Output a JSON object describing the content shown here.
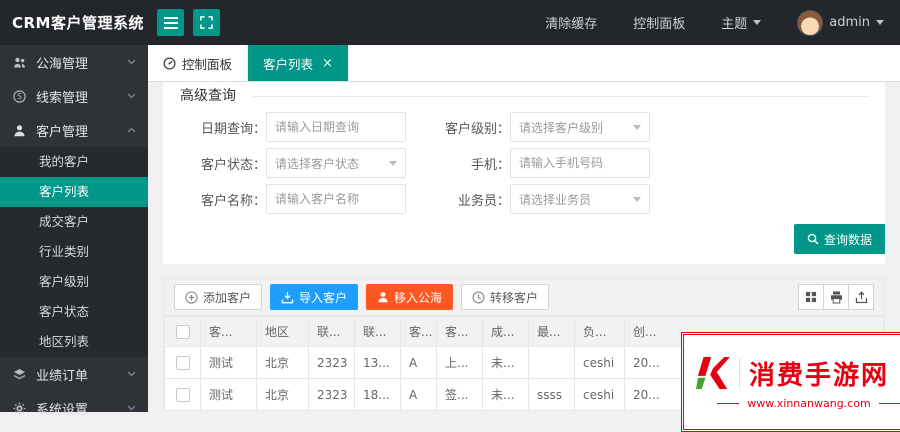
{
  "app": {
    "title": "CRM客户管理系统"
  },
  "topnav": {
    "clear_cache": "清除缓存",
    "control_panel": "控制面板",
    "theme": "主题",
    "user": "admin"
  },
  "sidebar": {
    "items": [
      {
        "label": "公海管理"
      },
      {
        "label": "线索管理"
      },
      {
        "label": "客户管理",
        "children": [
          "我的客户",
          "客户列表",
          "成交客户",
          "行业类别",
          "客户级别",
          "客户状态",
          "地区列表"
        ]
      },
      {
        "label": "业绩订单"
      },
      {
        "label": "系统设置"
      }
    ]
  },
  "tabs": [
    {
      "label": "控制面板"
    },
    {
      "label": "客户列表",
      "close": "×"
    }
  ],
  "query": {
    "title": "高级查询",
    "fields": [
      {
        "label": "日期查询：",
        "placeholder": "请输入日期查询"
      },
      {
        "label": "客户级别：",
        "placeholder": "请选择客户级别"
      },
      {
        "label": "客户状态：",
        "placeholder": "请选择客户状态"
      },
      {
        "label": "手机：",
        "placeholder": "请输入手机号码"
      },
      {
        "label": "客户名称：",
        "placeholder": "请输入客户名称"
      },
      {
        "label": "业务员：",
        "placeholder": "请选择业务员"
      }
    ],
    "search_button": "查询数据"
  },
  "toolbar": {
    "add": "添加客户",
    "import": "导入客户",
    "move_to_sea": "移入公海",
    "transfer": "转移客户"
  },
  "table": {
    "headers": [
      "客...",
      "地区",
      "联...",
      "联...",
      "客...",
      "客...",
      "成...",
      "最...",
      "负...",
      "创..."
    ],
    "rows": [
      [
        "测试",
        "北京",
        "2323",
        "13...",
        "A",
        "上...",
        "未...",
        "",
        "ceshi",
        "20..."
      ],
      [
        "测试",
        "北京",
        "2323",
        "18...",
        "A",
        "签...",
        "未...",
        "ssss",
        "ceshi",
        "20..."
      ]
    ]
  },
  "watermark": {
    "title": "消费手游网",
    "url": "www.xinnanwang.com"
  },
  "colors": {
    "accent_teal": "#009688",
    "blue": "#1e9fff",
    "orange": "#ff5722",
    "watermark_red": "#e60012"
  }
}
